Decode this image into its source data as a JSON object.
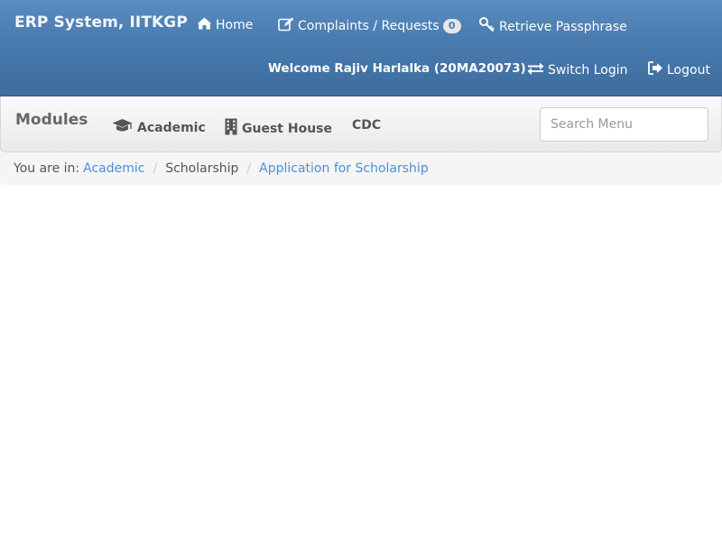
{
  "brand": "ERP System, IITKGP",
  "nav": {
    "home": "Home",
    "complaints": "Complaints / Requests",
    "complaints_count": "0",
    "retrieve": "Retrieve Passphrase",
    "welcome": "Welcome Rajiv Harlalka (20MA20073)",
    "switch_login": "Switch Login",
    "logout": "Logout"
  },
  "modules": {
    "title": "Modules",
    "items": [
      "Academic",
      "Guest House",
      "CDC"
    ],
    "search_placeholder": "Search Menu"
  },
  "breadcrumb": {
    "prefix": "You are in:",
    "items": [
      "Academic",
      "Scholarship",
      "Application for Scholarship"
    ]
  },
  "icons": {
    "home": "home-icon",
    "complaints": "edit-icon",
    "retrieve": "key-icon",
    "switch": "transfer-icon",
    "logout": "logout-icon",
    "academic": "graduation-cap-icon",
    "guest_house": "building-icon"
  },
  "colors": {
    "navbar": "#4a7cb0",
    "link": "#4a90d6",
    "modules_text": "#555555"
  }
}
